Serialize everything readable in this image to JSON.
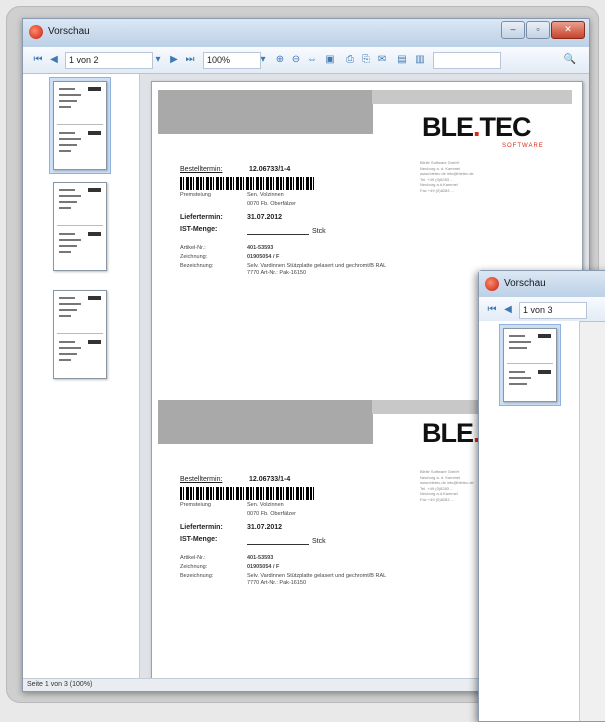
{
  "window": {
    "title": "Vorschau",
    "buttons": [
      "–",
      "▫",
      "✕"
    ]
  },
  "toolbar": {
    "first_icon": "first-page-icon",
    "prev_icon": "prev-page-icon",
    "page_value": "1 von 2",
    "next_icon": "next-page-icon",
    "last_icon": "last-page-icon",
    "zoom_value": "100%"
  },
  "statusbar": {
    "text": "Seite 1 von 3 (100%)"
  },
  "document": {
    "logo_main": "BLE",
    "logo_dot": ".",
    "logo_tail": "TEC",
    "logo_sub": "SOFTWARE",
    "address": "Bleile Software GmbH\nNeuburg a. d. Kammel\nwww.bletec.de info@bletec.de\nTel. +49 (0)8283 ...\nNeuburg a.d.Kammel\nFax +49 (0)8283 ...",
    "label_1": {
      "order_label": "Bestelltermin:",
      "order_value": "12.06733/1-4",
      "delivery_label": "Premsteiung",
      "delivery_value_1": "Sen. Volzinnen",
      "delivery_value_2": "0070 Fb. Oberfälzer",
      "date_label": "Liefertermin:",
      "date_value": "31.07.2012",
      "qty_label": "IST-Menge:",
      "qty_unit": "Stck",
      "article_label": "Artikel-Nr.:",
      "article_value": "401-53593",
      "drawing_label": "Zeichnung:",
      "drawing_value": "01905054 / F",
      "desc_label": "Bezeichnung:",
      "desc_value_1": "Selv. Vardinnen Stützplatte gelasert und gechromt/B RAL",
      "desc_value_2": "7770 Art-Nr.: Pak-16150"
    },
    "label_2": {
      "order_label": "Bestelltermin:",
      "order_value": "12.06733/1-4",
      "delivery_label": "Premsteiung",
      "delivery_value_1": "Sen. Volzinnen",
      "delivery_value_2": "0070 Fb. Oberfälzer",
      "date_label": "Liefertermin:",
      "date_value": "31.07.2012",
      "qty_label": "IST-Menge:",
      "qty_unit": "Stck",
      "article_label": "Artikel-Nr.:",
      "article_value": "401-53593",
      "drawing_label": "Zeichnung:",
      "drawing_value": "01905054 / F",
      "desc_label": "Bezeichnung:",
      "desc_value_1": "Selv. Vardinnen Stützplatte gelasert und gechromt/B RAL",
      "desc_value_2": "7770 Art-Nr.: Pak-16150"
    }
  },
  "window2": {
    "title": "Vorschau",
    "page_value": "1 von 3"
  }
}
